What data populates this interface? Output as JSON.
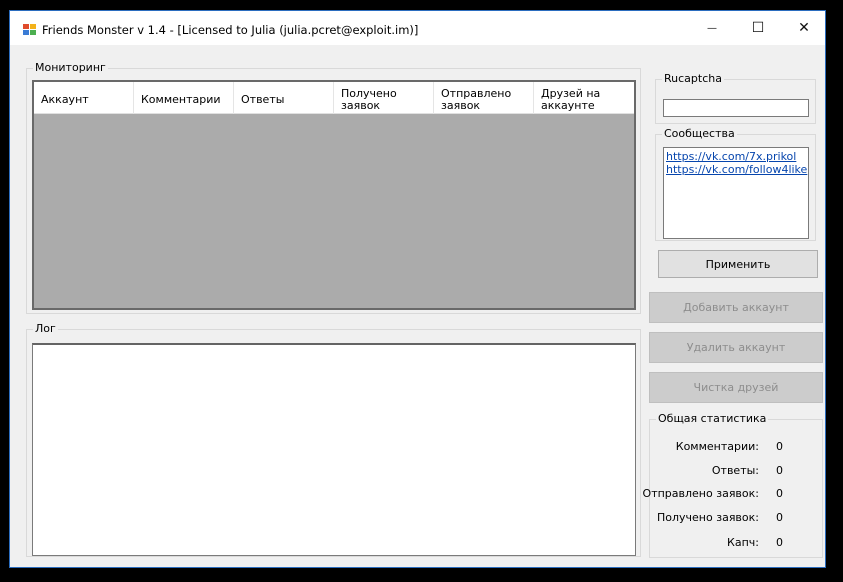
{
  "window": {
    "title": "Friends Monster v 1.4 - [Licensed to Julia (julia.pcret@exploit.im)]",
    "minimize_glyph": "—",
    "maximize_glyph": "☐",
    "close_glyph": "✕"
  },
  "monitoring": {
    "legend": "Мониторинг",
    "columns": [
      "Аккаунт",
      "Комментарии",
      "Ответы",
      "Получено заявок",
      "Отправлено заявок",
      "Друзей на аккаунте"
    ]
  },
  "log": {
    "legend": "Лог"
  },
  "rucaptcha": {
    "legend": "Rucaptcha",
    "value": ""
  },
  "communities": {
    "legend": "Сообщества",
    "links": [
      "https://vk.com/7x.prikol",
      "https://vk.com/follow4like"
    ]
  },
  "buttons": {
    "apply": "Применить",
    "add_account": "Добавить аккаунт",
    "remove_account": "Удалить аккаунт",
    "clean_friends": "Чистка друзей"
  },
  "stats": {
    "legend": "Общая статистика",
    "items": [
      {
        "label": "Комментарии:",
        "value": "0"
      },
      {
        "label": "Ответы:",
        "value": "0"
      },
      {
        "label": "Отправлено заявок:",
        "value": "0"
      },
      {
        "label": "Получено заявок:",
        "value": "0"
      },
      {
        "label": "Капч:",
        "value": "0"
      }
    ]
  },
  "colors": {
    "grid_background": "#ababab",
    "link": "#0645ad",
    "window_border": "#2b6dbf"
  }
}
